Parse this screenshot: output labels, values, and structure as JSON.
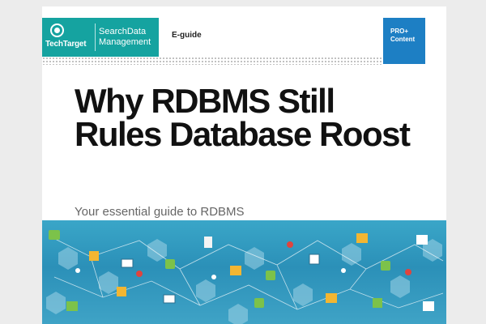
{
  "header": {
    "logo": {
      "brand": "TechTarget",
      "line1": "SearchData",
      "line2": "Management"
    },
    "doc_type": "E-guide",
    "badge": {
      "line1": "PRO+",
      "line2": "Content"
    }
  },
  "cover": {
    "title": "Why RDBMS Still Rules Database Roost",
    "subtitle": "Your essential guide to RDBMS"
  },
  "colors": {
    "teal": "#15a3a0",
    "blue": "#1d7fc4",
    "art_blue": "#2b90b8"
  }
}
